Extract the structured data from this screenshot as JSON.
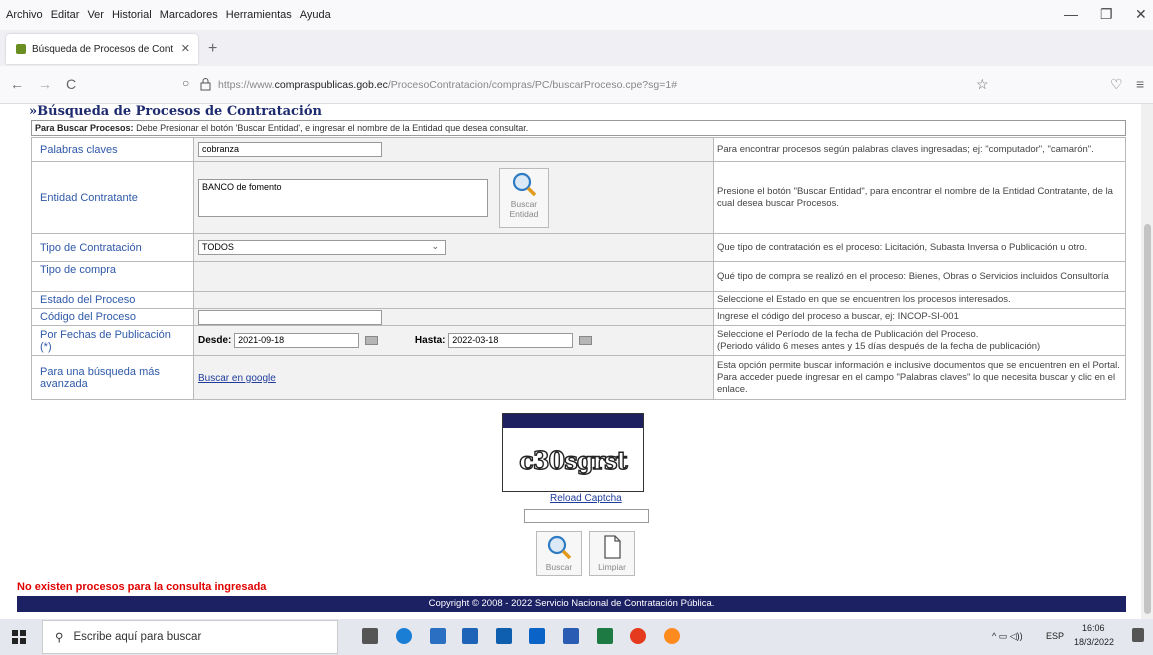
{
  "menu": [
    "Archivo",
    "Editar",
    "Ver",
    "Historial",
    "Marcadores",
    "Herramientas",
    "Ayuda"
  ],
  "window_controls": {
    "minimize": "—",
    "maximize": "❐",
    "close": "✕"
  },
  "tab": {
    "title": "Búsqueda de Procesos de Cont",
    "close": "✕",
    "new_tab": "+"
  },
  "nav": {
    "back": "←",
    "forward": "→",
    "reload": "C",
    "url_prefix": "https://www.",
    "url_host": "compraspublicas.gob.ec",
    "url_path": "/ProcesoContratacion/compras/PC/buscarProceso.cpe?sg=1#",
    "star": "☆",
    "pocket": "♡",
    "menu": "≡"
  },
  "page": {
    "title": "»Búsqueda de Procesos de Contratación",
    "instructions_bold": "Para Buscar Procesos:",
    "instructions_text": " Debe Presionar el botón 'Buscar Entidad', e ingresar el nombre de la Entidad que desea consultar.",
    "rows": {
      "palabras": {
        "label": "Palabras claves",
        "value": "cobranza",
        "help": "Para encontrar procesos según palabras claves ingresadas; ej: \"computador\", \"camarón\"."
      },
      "entidad": {
        "label": "Entidad Contratante",
        "value": "BANCO de fomento",
        "button": "Buscar",
        "button2": "Entidad",
        "help": "Presione el botón \"Buscar Entidad\", para encontrar el nombre de la Entidad Contratante, de la cual desea buscar Procesos."
      },
      "tipo_contratacion": {
        "label": "Tipo de Contratación",
        "value": "TODOS",
        "help": "Que tipo de contratación es el proceso: Licitación, Subasta Inversa o Publicación u otro."
      },
      "tipo_compra": {
        "label": "Tipo de compra",
        "help": "Qué tipo de compra se realizó en el proceso: Bienes, Obras o Servicios incluidos Consultoría"
      },
      "estado": {
        "label": "Estado del Proceso",
        "help": "Seleccione el Estado en que se encuentren los procesos interesados."
      },
      "codigo": {
        "label": "Código del Proceso",
        "value": "",
        "help": "Ingrese el código del proceso a buscar, ej: INCOP-SI-001"
      },
      "fechas": {
        "label": "Por Fechas de Publicación (*)",
        "desde_label": "Desde:",
        "desde": "2021-09-18",
        "hasta_label": "Hasta:",
        "hasta": "2022-03-18",
        "help1": "Seleccione el Período de la fecha de Publicación del Proceso.",
        "help2": "(Periodo válido 6 meses antes y 15 días después de la fecha de publicación)"
      },
      "avanzada": {
        "label": "Para una búsqueda más avanzada",
        "link": "Buscar en google",
        "help": "Esta opción permite buscar información e inclusive documentos que se encuentren en el Portal. Para acceder puede ingresar en el campo \"Palabras claves\" lo que necesita buscar y clic en el enlace."
      }
    },
    "captcha_text": "c30sgrst",
    "reload_captcha": "Reload Captcha",
    "buscar": "Buscar",
    "limpiar": "Limpiar",
    "no_results": "No existen procesos para la consulta ingresada",
    "footer": "Copyright © 2008 - 2022 Servicio Nacional de Contratación Pública."
  },
  "taskbar": {
    "search_placeholder": "Escribe aquí para buscar",
    "lang": "ESP",
    "time": "16:06",
    "date": "18/3/2022"
  }
}
